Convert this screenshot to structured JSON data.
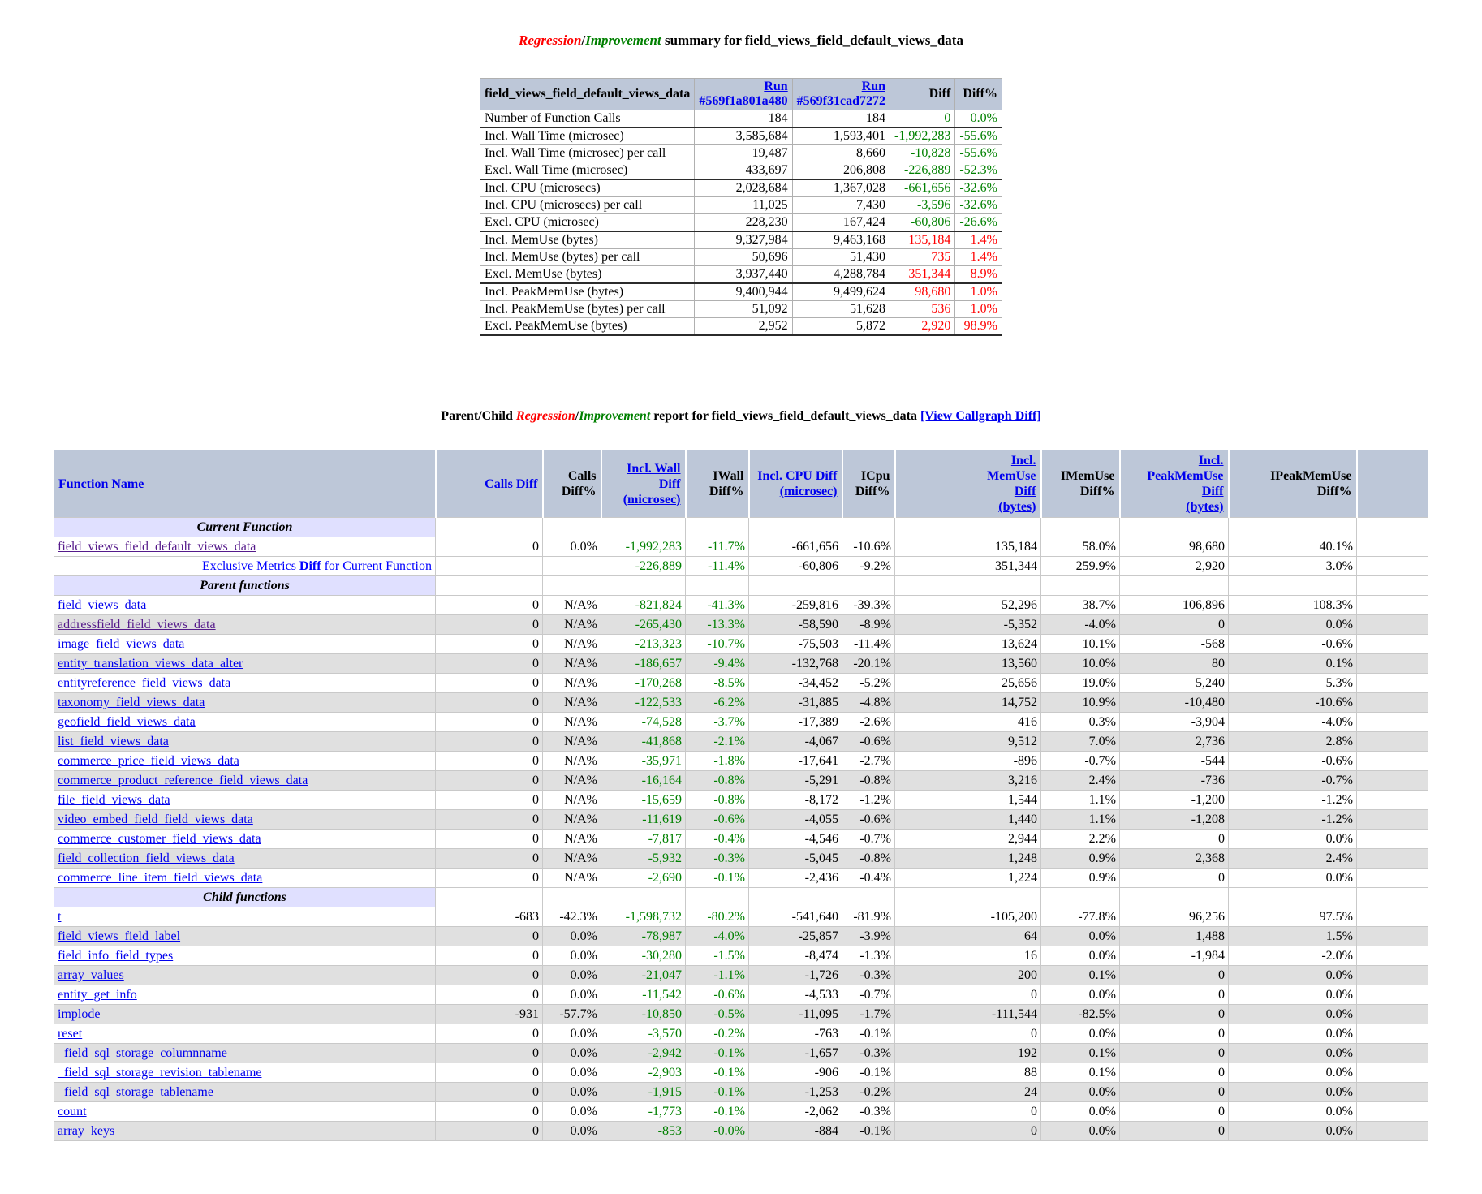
{
  "titles": {
    "summary": {
      "regression": "Regression",
      "slash": "/",
      "improvement": "Improvement",
      "rest": " summary for field_views_field_default_views_data"
    },
    "report": {
      "prefix": "Parent/Child ",
      "regression": "Regression",
      "slash": "/",
      "improvement": "Improvement",
      "middle": " report for field_views_field_default_views_data ",
      "callgraph_link": "[View Callgraph Diff]"
    }
  },
  "colors": {
    "improvement": "#008000",
    "regression": "#ff0000",
    "header_bg": "#bdc7d8",
    "section_bg": "#e0e0ff",
    "shade_bg": "#e0e0e0",
    "link": "#0000ee",
    "visited_link": "#551a8b",
    "exclusive_text": "#0000ff"
  },
  "summary_table": {
    "header": {
      "label": "field_views_field_default_views_data",
      "run1_line1": "Run",
      "run1_id": "#569f1a801a480",
      "run2_line1": "Run",
      "run2_id": "#569f31cad7272",
      "diff": "Diff",
      "diff_pct": "Diff%"
    },
    "rows": [
      {
        "metric": "Number of Function Calls",
        "run1": "184",
        "run2": "184",
        "diff": "0",
        "diff_pct": "0.0%",
        "dir": "better"
      },
      {
        "metric": "Incl. Wall Time (microsec)",
        "run1": "3,585,684",
        "run2": "1,593,401",
        "diff": "-1,992,283",
        "diff_pct": "-55.6%",
        "dir": "better"
      },
      {
        "metric": "Incl. Wall Time (microsec) per call",
        "run1": "19,487",
        "run2": "8,660",
        "diff": "-10,828",
        "diff_pct": "-55.6%",
        "dir": "better"
      },
      {
        "metric": "Excl. Wall Time (microsec)",
        "run1": "433,697",
        "run2": "206,808",
        "diff": "-226,889",
        "diff_pct": "-52.3%",
        "dir": "better"
      },
      {
        "metric": "Incl. CPU (microsecs)",
        "run1": "2,028,684",
        "run2": "1,367,028",
        "diff": "-661,656",
        "diff_pct": "-32.6%",
        "dir": "better"
      },
      {
        "metric": "Incl. CPU (microsecs) per call",
        "run1": "11,025",
        "run2": "7,430",
        "diff": "-3,596",
        "diff_pct": "-32.6%",
        "dir": "better"
      },
      {
        "metric": "Excl. CPU (microsec)",
        "run1": "228,230",
        "run2": "167,424",
        "diff": "-60,806",
        "diff_pct": "-26.6%",
        "dir": "better"
      },
      {
        "metric": "Incl. MemUse (bytes)",
        "run1": "9,327,984",
        "run2": "9,463,168",
        "diff": "135,184",
        "diff_pct": "1.4%",
        "dir": "worse"
      },
      {
        "metric": "Incl. MemUse (bytes) per call",
        "run1": "50,696",
        "run2": "51,430",
        "diff": "735",
        "diff_pct": "1.4%",
        "dir": "worse"
      },
      {
        "metric": "Excl. MemUse (bytes)",
        "run1": "3,937,440",
        "run2": "4,288,784",
        "diff": "351,344",
        "diff_pct": "8.9%",
        "dir": "worse"
      },
      {
        "metric": "Incl. PeakMemUse (bytes)",
        "run1": "9,400,944",
        "run2": "9,499,624",
        "diff": "98,680",
        "diff_pct": "1.0%",
        "dir": "worse"
      },
      {
        "metric": "Incl. PeakMemUse (bytes) per call",
        "run1": "51,092",
        "run2": "51,628",
        "diff": "536",
        "diff_pct": "1.0%",
        "dir": "worse"
      },
      {
        "metric": "Excl. PeakMemUse (bytes)",
        "run1": "2,952",
        "run2": "5,872",
        "diff": "2,920",
        "diff_pct": "98.9%",
        "dir": "worse"
      }
    ]
  },
  "report_table": {
    "headers": [
      {
        "key": "function-name",
        "lines": [
          "Function Name"
        ],
        "link": true,
        "align": "left"
      },
      {
        "key": "calls-diff",
        "lines": [
          "Calls Diff"
        ],
        "link": true,
        "align": "right"
      },
      {
        "key": "calls-diff-pct",
        "lines": [
          "Calls",
          "Diff%"
        ],
        "link": false,
        "align": "right"
      },
      {
        "key": "incl-wall-diff",
        "lines": [
          "Incl. Wall",
          "Diff",
          "(microsec)"
        ],
        "link": true,
        "align": "right"
      },
      {
        "key": "iwall-diff-pct",
        "lines": [
          "IWall",
          "Diff%"
        ],
        "link": false,
        "align": "right"
      },
      {
        "key": "incl-cpu-diff",
        "lines": [
          "Incl. CPU Diff",
          "(microsec)"
        ],
        "link": true,
        "align": "right"
      },
      {
        "key": "icpu-diff-pct",
        "lines": [
          "ICpu",
          "Diff%"
        ],
        "link": false,
        "align": "right"
      },
      {
        "key": "incl-memuse-diff",
        "lines": [
          "Incl.",
          "MemUse",
          "Diff",
          "(bytes)"
        ],
        "link": true,
        "align": "right"
      },
      {
        "key": "imemuse-diff-pct",
        "lines": [
          "IMemUse",
          "Diff%"
        ],
        "link": false,
        "align": "right"
      },
      {
        "key": "incl-peakmemuse-diff",
        "lines": [
          "Incl.",
          "PeakMemUse",
          "Diff",
          "(bytes)"
        ],
        "link": true,
        "align": "right"
      },
      {
        "key": "ipeakmemuse-diff-pct",
        "lines": [
          "IPeakMemUse",
          "Diff%"
        ],
        "link": false,
        "align": "right"
      },
      {
        "key": "spacer",
        "lines": [],
        "link": false,
        "align": "right"
      }
    ],
    "sections": [
      {
        "title": "Current Function",
        "alternate": false,
        "rows": [
          {
            "type": "fn",
            "name": "field_views_field_default_views_data",
            "visited": true,
            "values": [
              "0",
              "0.0%",
              "-1,992,283",
              "-11.7%",
              "-661,656",
              "-10.6%",
              "135,184",
              "58.0%",
              "98,680",
              "40.1%"
            ]
          },
          {
            "type": "exclusive",
            "label_pre": "Exclusive Metrics ",
            "label_bold": "Diff",
            "label_post": " for Current Function",
            "values": [
              "",
              "",
              "-226,889",
              "-11.4%",
              "-60,806",
              "-9.2%",
              "351,344",
              "259.9%",
              "2,920",
              "3.0%"
            ]
          }
        ]
      },
      {
        "title": "Parent functions",
        "alternate": true,
        "rows": [
          {
            "type": "fn",
            "name": "field_views_data",
            "visited": false,
            "values": [
              "0",
              "N/A%",
              "-821,824",
              "-41.3%",
              "-259,816",
              "-39.3%",
              "52,296",
              "38.7%",
              "106,896",
              "108.3%"
            ]
          },
          {
            "type": "fn",
            "name": "addressfield_field_views_data",
            "visited": true,
            "values": [
              "0",
              "N/A%",
              "-265,430",
              "-13.3%",
              "-58,590",
              "-8.9%",
              "-5,352",
              "-4.0%",
              "0",
              "0.0%"
            ]
          },
          {
            "type": "fn",
            "name": "image_field_views_data",
            "visited": false,
            "values": [
              "0",
              "N/A%",
              "-213,323",
              "-10.7%",
              "-75,503",
              "-11.4%",
              "13,624",
              "10.1%",
              "-568",
              "-0.6%"
            ]
          },
          {
            "type": "fn",
            "name": "entity_translation_views_data_alter",
            "visited": false,
            "values": [
              "0",
              "N/A%",
              "-186,657",
              "-9.4%",
              "-132,768",
              "-20.1%",
              "13,560",
              "10.0%",
              "80",
              "0.1%"
            ]
          },
          {
            "type": "fn",
            "name": "entityreference_field_views_data",
            "visited": false,
            "values": [
              "0",
              "N/A%",
              "-170,268",
              "-8.5%",
              "-34,452",
              "-5.2%",
              "25,656",
              "19.0%",
              "5,240",
              "5.3%"
            ]
          },
          {
            "type": "fn",
            "name": "taxonomy_field_views_data",
            "visited": false,
            "values": [
              "0",
              "N/A%",
              "-122,533",
              "-6.2%",
              "-31,885",
              "-4.8%",
              "14,752",
              "10.9%",
              "-10,480",
              "-10.6%"
            ]
          },
          {
            "type": "fn",
            "name": "geofield_field_views_data",
            "visited": false,
            "values": [
              "0",
              "N/A%",
              "-74,528",
              "-3.7%",
              "-17,389",
              "-2.6%",
              "416",
              "0.3%",
              "-3,904",
              "-4.0%"
            ]
          },
          {
            "type": "fn",
            "name": "list_field_views_data",
            "visited": false,
            "values": [
              "0",
              "N/A%",
              "-41,868",
              "-2.1%",
              "-4,067",
              "-0.6%",
              "9,512",
              "7.0%",
              "2,736",
              "2.8%"
            ]
          },
          {
            "type": "fn",
            "name": "commerce_price_field_views_data",
            "visited": false,
            "values": [
              "0",
              "N/A%",
              "-35,971",
              "-1.8%",
              "-17,641",
              "-2.7%",
              "-896",
              "-0.7%",
              "-544",
              "-0.6%"
            ]
          },
          {
            "type": "fn",
            "name": "commerce_product_reference_field_views_data",
            "visited": false,
            "values": [
              "0",
              "N/A%",
              "-16,164",
              "-0.8%",
              "-5,291",
              "-0.8%",
              "3,216",
              "2.4%",
              "-736",
              "-0.7%"
            ]
          },
          {
            "type": "fn",
            "name": "file_field_views_data",
            "visited": false,
            "values": [
              "0",
              "N/A%",
              "-15,659",
              "-0.8%",
              "-8,172",
              "-1.2%",
              "1,544",
              "1.1%",
              "-1,200",
              "-1.2%"
            ]
          },
          {
            "type": "fn",
            "name": "video_embed_field_field_views_data",
            "visited": false,
            "values": [
              "0",
              "N/A%",
              "-11,619",
              "-0.6%",
              "-4,055",
              "-0.6%",
              "1,440",
              "1.1%",
              "-1,208",
              "-1.2%"
            ]
          },
          {
            "type": "fn",
            "name": "commerce_customer_field_views_data",
            "visited": false,
            "values": [
              "0",
              "N/A%",
              "-7,817",
              "-0.4%",
              "-4,546",
              "-0.7%",
              "2,944",
              "2.2%",
              "0",
              "0.0%"
            ]
          },
          {
            "type": "fn",
            "name": "field_collection_field_views_data",
            "visited": false,
            "values": [
              "0",
              "N/A%",
              "-5,932",
              "-0.3%",
              "-5,045",
              "-0.8%",
              "1,248",
              "0.9%",
              "2,368",
              "2.4%"
            ]
          },
          {
            "type": "fn",
            "name": "commerce_line_item_field_views_data",
            "visited": false,
            "values": [
              "0",
              "N/A%",
              "-2,690",
              "-0.1%",
              "-2,436",
              "-0.4%",
              "1,224",
              "0.9%",
              "0",
              "0.0%"
            ]
          }
        ]
      },
      {
        "title": "Child functions",
        "alternate": true,
        "rows": [
          {
            "type": "fn",
            "name": "t",
            "visited": false,
            "values": [
              "-683",
              "-42.3%",
              "-1,598,732",
              "-80.2%",
              "-541,640",
              "-81.9%",
              "-105,200",
              "-77.8%",
              "96,256",
              "97.5%"
            ]
          },
          {
            "type": "fn",
            "name": "field_views_field_label",
            "visited": false,
            "values": [
              "0",
              "0.0%",
              "-78,987",
              "-4.0%",
              "-25,857",
              "-3.9%",
              "64",
              "0.0%",
              "1,488",
              "1.5%"
            ]
          },
          {
            "type": "fn",
            "name": "field_info_field_types",
            "visited": false,
            "values": [
              "0",
              "0.0%",
              "-30,280",
              "-1.5%",
              "-8,474",
              "-1.3%",
              "16",
              "0.0%",
              "-1,984",
              "-2.0%"
            ]
          },
          {
            "type": "fn",
            "name": "array_values",
            "visited": false,
            "values": [
              "0",
              "0.0%",
              "-21,047",
              "-1.1%",
              "-1,726",
              "-0.3%",
              "200",
              "0.1%",
              "0",
              "0.0%"
            ]
          },
          {
            "type": "fn",
            "name": "entity_get_info",
            "visited": false,
            "values": [
              "0",
              "0.0%",
              "-11,542",
              "-0.6%",
              "-4,533",
              "-0.7%",
              "0",
              "0.0%",
              "0",
              "0.0%"
            ]
          },
          {
            "type": "fn",
            "name": "implode",
            "visited": false,
            "values": [
              "-931",
              "-57.7%",
              "-10,850",
              "-0.5%",
              "-11,095",
              "-1.7%",
              "-111,544",
              "-82.5%",
              "0",
              "0.0%"
            ]
          },
          {
            "type": "fn",
            "name": "reset",
            "visited": false,
            "values": [
              "0",
              "0.0%",
              "-3,570",
              "-0.2%",
              "-763",
              "-0.1%",
              "0",
              "0.0%",
              "0",
              "0.0%"
            ]
          },
          {
            "type": "fn",
            "name": "_field_sql_storage_columnname",
            "visited": false,
            "values": [
              "0",
              "0.0%",
              "-2,942",
              "-0.1%",
              "-1,657",
              "-0.3%",
              "192",
              "0.1%",
              "0",
              "0.0%"
            ]
          },
          {
            "type": "fn",
            "name": "_field_sql_storage_revision_tablename",
            "visited": false,
            "values": [
              "0",
              "0.0%",
              "-2,903",
              "-0.1%",
              "-906",
              "-0.1%",
              "88",
              "0.1%",
              "0",
              "0.0%"
            ]
          },
          {
            "type": "fn",
            "name": "_field_sql_storage_tablename",
            "visited": false,
            "values": [
              "0",
              "0.0%",
              "-1,915",
              "-0.1%",
              "-1,253",
              "-0.2%",
              "24",
              "0.0%",
              "0",
              "0.0%"
            ]
          },
          {
            "type": "fn",
            "name": "count",
            "visited": false,
            "values": [
              "0",
              "0.0%",
              "-1,773",
              "-0.1%",
              "-2,062",
              "-0.3%",
              "0",
              "0.0%",
              "0",
              "0.0%"
            ]
          },
          {
            "type": "fn",
            "name": "array_keys",
            "visited": false,
            "values": [
              "0",
              "0.0%",
              "-853",
              "-0.0%",
              "-884",
              "-0.1%",
              "0",
              "0.0%",
              "0",
              "0.0%"
            ]
          }
        ]
      }
    ]
  }
}
